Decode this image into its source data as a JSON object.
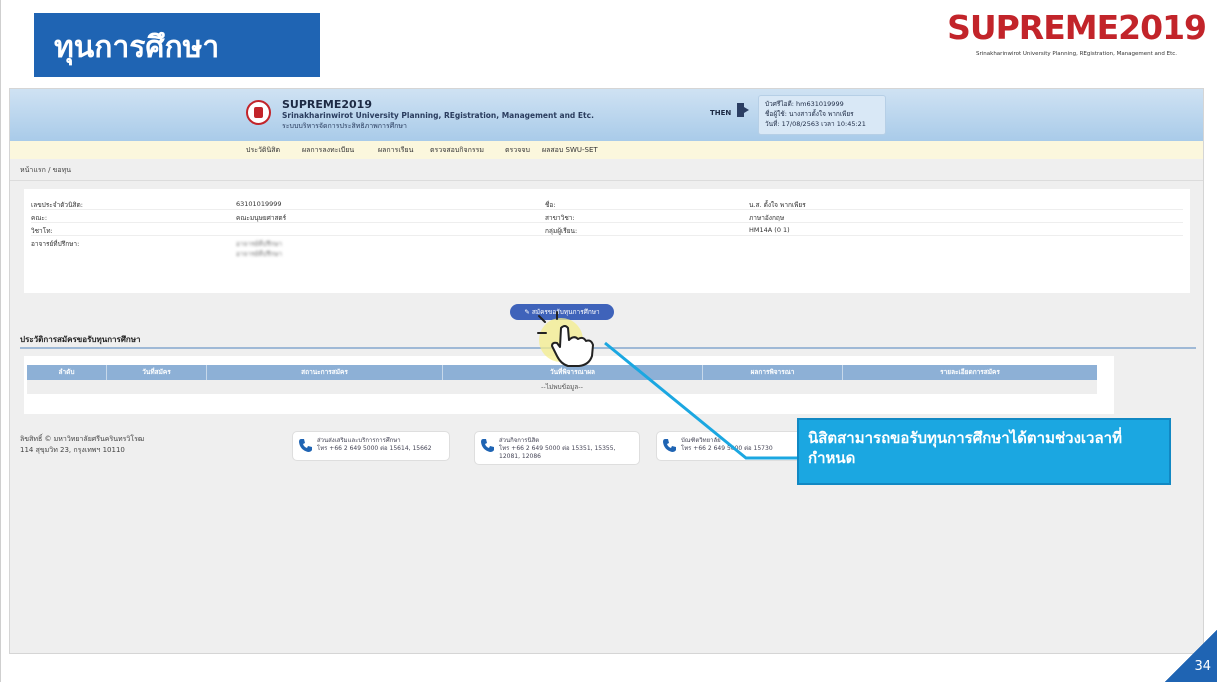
{
  "slide": {
    "title": "ทุนการศึกษา",
    "logo_text": "SUPREME2019",
    "logo_subtitle": "Srinakharinwirot University Planning, REgistration, Management and Etc.",
    "page_number": "34",
    "callout_text": "นิสิตสามารถขอรับทุนการศึกษาได้ตามช่วงเวลาที่กำหนด"
  },
  "web": {
    "site_name": "SUPREME2019",
    "site_desc": "Srinakharinwirot University Planning, REgistration, Management and Etc.",
    "site_desc_th": "ระบบบริหารจัดการประสิทธิภาพการศึกษา",
    "lang": "THEN",
    "user": {
      "id_line": "บัวศรีไอดี: hm631019999",
      "name_line": "ชื่อผู้ใช้: นางสาวตั้งใจ พากเพียร",
      "date_line": "วันที่: 17/08/2563 เวลา 10:45:21"
    },
    "menu": [
      "ประวัตินิสิต",
      "ผลการลงทะเบียน",
      "ผลการเรียน",
      "ตรวจสอบกิจกรรม",
      "ตรวจจบ",
      "ผลสอบ SWU-SET"
    ],
    "breadcrumb": "หน้าแรก / ขอทุน",
    "info": {
      "student_id_label": "เลขประจำตัวนิสิต:",
      "student_id": "63101019999",
      "name_label": "ชื่อ:",
      "name": "น.ส. ตั้งใจ พากเพียร",
      "faculty_label": "คณะ:",
      "faculty": "คณะมนุษยศาสตร์",
      "major_label": "สาขาวิชา:",
      "major": "ภาษาอังกฤษ",
      "minor_label": "วิชาโท:",
      "group_label": "กลุ่มผู้เรียน:",
      "group": "HM14A (0 1)",
      "advisor_label": "อาจารย์ที่ปรึกษา:",
      "advisor_1": "อาจารย์ที่ปรึกษา",
      "advisor_2": "อาจารย์ที่ปรึกษา"
    },
    "apply_button": "สมัครขอรับทุนการศึกษา",
    "history_title": "ประวัติการสมัครขอรับทุนการศึกษา",
    "table": {
      "headers": [
        "ลำดับ",
        "วันที่สมัคร",
        "สถานะการสมัคร",
        "วันที่พิจารณาผล",
        "ผลการพิจารณา",
        "รายละเอียดการสมัคร"
      ],
      "empty_text": "--ไม่พบข้อมูล--"
    },
    "footer": {
      "copyright": "ลิขสิทธิ์ © มหาวิทยาลัยศรีนครินทรวิโรฒ",
      "address": "114 สุขุมวิท 23, กรุงเทพฯ 10110",
      "contacts": [
        {
          "name": "ส่วนส่งเสริมและบริการการศึกษา",
          "phone": "โทร +66 2 649 5000 ต่อ 15614, 15662",
          "phone2": ""
        },
        {
          "name": "ส่วนกิจการนิสิต",
          "phone": "โทร +66 2 649 5000 ต่อ 15351, 15355,",
          "phone2": "12081, 12086"
        },
        {
          "name": "บัณฑิตวิทยาลัย",
          "phone": "โทร +66 2 649 5000 ต่อ 15730",
          "phone2": ""
        }
      ]
    }
  },
  "colors": {
    "banner": "#1f64b3",
    "logo_red": "#c2242a",
    "callout": "#1ba7e1",
    "highlight": "#f4ee8c"
  }
}
